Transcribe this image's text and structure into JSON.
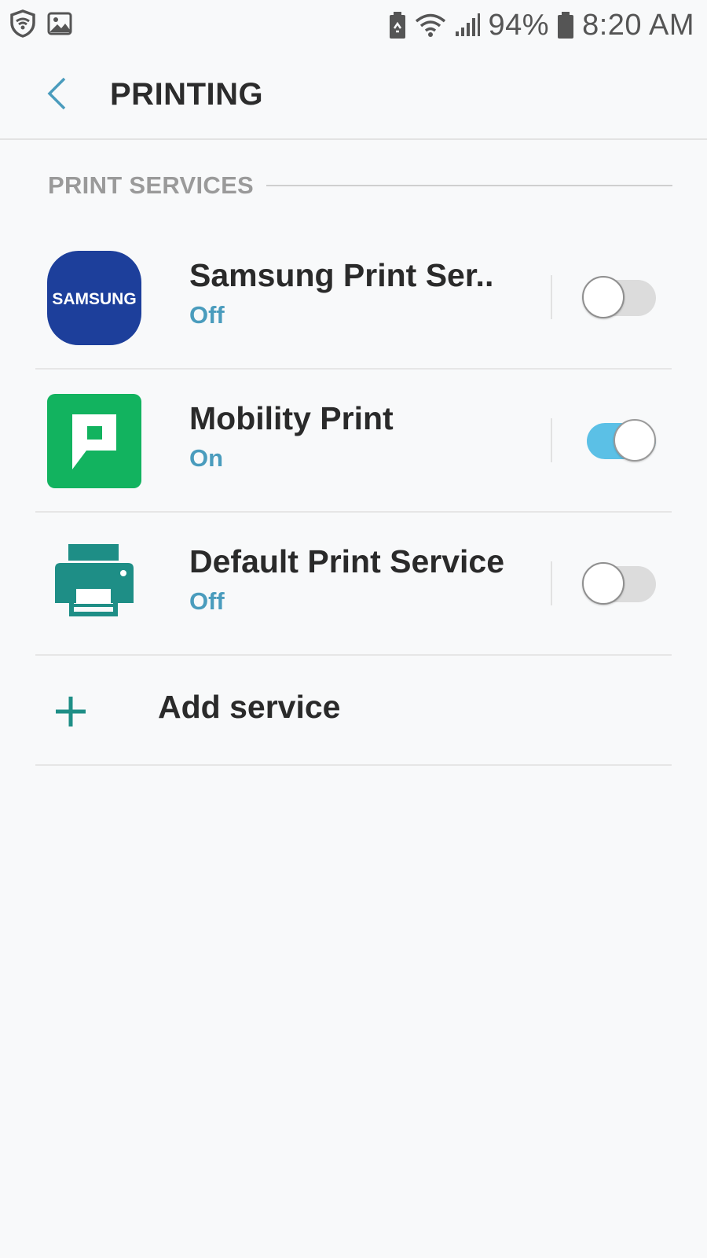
{
  "status_bar": {
    "battery_percent": "94%",
    "time": "8:20 AM",
    "icons_left": [
      "shield-wifi-icon",
      "image-icon"
    ],
    "icons_right": [
      "battery-saver-icon",
      "wifi-icon",
      "signal-icon",
      "battery-icon"
    ]
  },
  "app_bar": {
    "title": "PRINTING",
    "back_icon": "chevron-left-icon",
    "accent_color": "#4a9cbd"
  },
  "section": {
    "title": "PRINT SERVICES"
  },
  "services": [
    {
      "name": "Samsung Print Ser..",
      "status": "Off",
      "enabled": false,
      "icon": "samsung-logo-icon",
      "logo_text": "SAMSUNG",
      "icon_color": "#1d3f9b"
    },
    {
      "name": "Mobility Print",
      "status": "On",
      "enabled": true,
      "icon": "mobility-print-icon",
      "icon_color": "#12b35f"
    },
    {
      "name": "Default Print Service",
      "status": "Off",
      "enabled": false,
      "icon": "printer-icon",
      "icon_color": "#1e8e86"
    }
  ],
  "add_service": {
    "label": "Add service",
    "icon": "plus-icon",
    "icon_color": "#1e8e86"
  },
  "colors": {
    "switch_on": "#5bc0e6",
    "switch_off": "#dcdcdc",
    "status_text": "#4a9cbd"
  }
}
